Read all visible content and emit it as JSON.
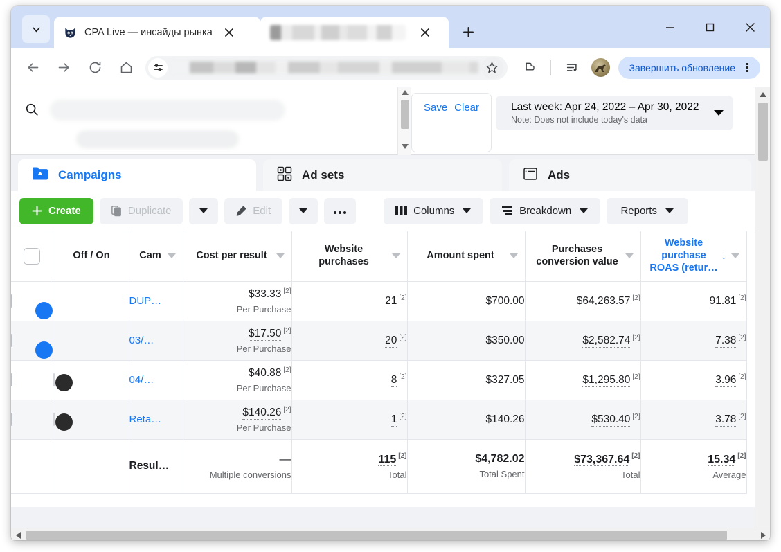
{
  "browser": {
    "tabs": [
      {
        "title": "CPA Live — инсайды рынка",
        "favicon": "cat-icon",
        "active": true,
        "redacted": false
      },
      {
        "title": "",
        "favicon": "redacted-favicon",
        "active": false,
        "redacted": true
      }
    ],
    "new_tab_label": "+",
    "window_controls": {
      "minimize": "minimize-icon",
      "maximize": "maximize-icon",
      "close": "close-icon"
    },
    "toolbar": {
      "back": "back-arrow-icon",
      "forward": "forward-arrow-icon",
      "reload": "reload-icon",
      "home": "home-icon",
      "site_info": "site-settings-icon",
      "url": "",
      "bookmark": "star-icon",
      "extensions": "extensions-puzzle-icon",
      "media": "media-list-icon",
      "profile": "profile-avatar",
      "update_label": "Завершить обновление",
      "menu": "kebab-menu-icon"
    }
  },
  "filter_bar": {
    "search_icon": "search-icon",
    "search_value": "",
    "save_label": "Save",
    "clear_label": "Clear",
    "date_range": {
      "main": "Last week: Apr 24, 2022 – Apr 30, 2022",
      "note": "Note: Does not include today's data"
    }
  },
  "object_tabs": [
    {
      "label": "Campaigns",
      "icon": "campaign-folder-icon",
      "active": true
    },
    {
      "label": "Ad sets",
      "icon": "adsets-grid-icon",
      "active": false
    },
    {
      "label": "Ads",
      "icon": "ads-window-icon",
      "active": false
    }
  ],
  "action_toolbar": {
    "create": "Create",
    "duplicate": "Duplicate",
    "duplicate_caret": "chevron-down-icon",
    "edit": "Edit",
    "edit_caret": "chevron-down-icon",
    "more": "more-ellipsis-icon",
    "columns": "Columns",
    "breakdown": "Breakdown",
    "reports": "Reports"
  },
  "table": {
    "columns": [
      {
        "key": "select",
        "label": "",
        "type": "checkbox"
      },
      {
        "key": "offon",
        "label": "Off / On",
        "type": "toggle"
      },
      {
        "key": "name",
        "label": "Cam",
        "type": "text",
        "has_caret": true
      },
      {
        "key": "cpr",
        "label": "Cost per result",
        "type": "num",
        "has_caret": true
      },
      {
        "key": "purchases",
        "label": "Website purchases",
        "type": "num",
        "has_caret": true
      },
      {
        "key": "spent",
        "label": "Amount spent",
        "type": "num",
        "has_caret": true
      },
      {
        "key": "convvalue",
        "label": "Purchases conversion value",
        "type": "num",
        "has_caret": true
      },
      {
        "key": "roas",
        "label": "Website purchase ROAS (retur…",
        "type": "num",
        "has_caret": true,
        "link": true,
        "sorted": "desc",
        "sort_icon": "↓"
      }
    ],
    "rows": [
      {
        "toggle": "on",
        "name": "DUP…",
        "cpr": "$33.33",
        "cpr_sup": "[2]",
        "cpr_sub": "Per Purchase",
        "purchases": "21",
        "purchases_sup": "[2]",
        "spent": "$700.00",
        "convvalue": "$64,263.57",
        "convvalue_sup": "[2]",
        "roas": "91.81",
        "roas_sup": "[2]"
      },
      {
        "toggle": "on",
        "name": "03/…",
        "cpr": "$17.50",
        "cpr_sup": "[2]",
        "cpr_sub": "Per Purchase",
        "purchases": "20",
        "purchases_sup": "[2]",
        "spent": "$350.00",
        "convvalue": "$2,582.74",
        "convvalue_sup": "[2]",
        "roas": "7.38",
        "roas_sup": "[2]"
      },
      {
        "toggle": "off",
        "name": "04/…",
        "cpr": "$40.88",
        "cpr_sup": "[2]",
        "cpr_sub": "Per Purchase",
        "purchases": "8",
        "purchases_sup": "[2]",
        "spent": "$327.05",
        "convvalue": "$1,295.80",
        "convvalue_sup": "[2]",
        "roas": "3.96",
        "roas_sup": "[2]"
      },
      {
        "toggle": "off",
        "name": "Reta…",
        "cpr": "$140.26",
        "cpr_sup": "[2]",
        "cpr_sub": "Per Purchase",
        "purchases": "1",
        "purchases_sup": "[2]",
        "spent": "$140.26",
        "convvalue": "$530.40",
        "convvalue_sup": "[2]",
        "roas": "3.78",
        "roas_sup": "[2]"
      }
    ],
    "totals": {
      "name": "Resul…",
      "cpr": "—",
      "cpr_sub": "Multiple conversions",
      "purchases": "115",
      "purchases_sup": "[2]",
      "purchases_sub": "Total",
      "spent": "$4,782.02",
      "spent_sub": "Total Spent",
      "convvalue": "$73,367.64",
      "convvalue_sup": "[2]",
      "convvalue_sub": "Total",
      "roas": "15.34",
      "roas_sup": "[2]",
      "roas_sub": "Average"
    }
  },
  "colors": {
    "brand_blue": "#1877f2",
    "create_green": "#42b72a",
    "chrome_tabstrip": "#cfddf7",
    "update_pill_bg": "#d3e3fd",
    "update_pill_text": "#0b57d0",
    "page_bg": "#f0f2f5"
  }
}
